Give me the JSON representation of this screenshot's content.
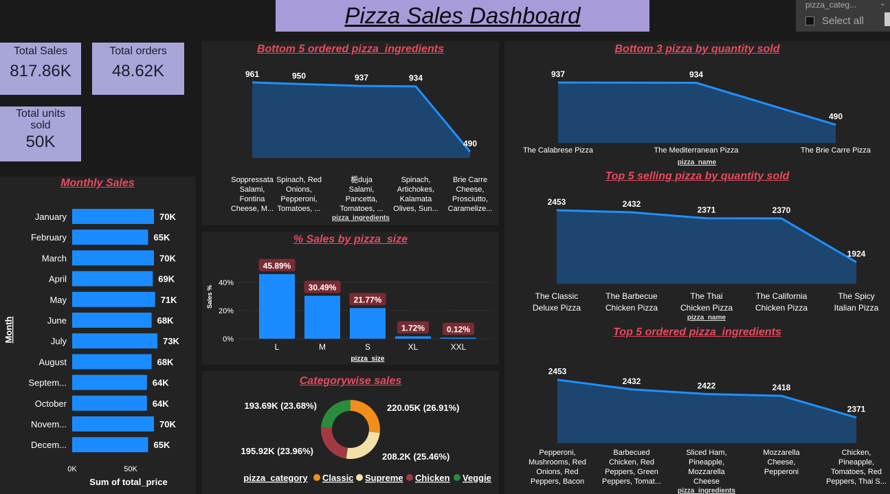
{
  "header": {
    "title": "Pizza Sales Dashboard",
    "slicer_label": "pizza_categ...",
    "slicer_select_all": "Select all"
  },
  "kpis": [
    {
      "label": "Total Sales",
      "value": "817.86K"
    },
    {
      "label": "Total orders",
      "value": "48.62K"
    },
    {
      "label": "Total units sold",
      "value": "50K"
    }
  ],
  "colors": {
    "line": "#1e90ff",
    "area": "#1c4570",
    "bar": "#1a8cff",
    "title": "#e84a5f",
    "classic": "#f28e1c",
    "supreme": "#f1e1a6",
    "chicken": "#a23a44",
    "veggie": "#2a8c3a"
  },
  "chart_data": [
    {
      "id": "bottom5ing",
      "type": "area",
      "title": "Bottom 5 ordered pizza_ingredients",
      "xlabel": "pizza_ingredients",
      "categories": [
        [
          "Soppressata",
          "Salami,",
          "Fontina",
          "Cheese, M..."
        ],
        [
          "Spinach, Red",
          "Onions,",
          "Pepperoni,",
          "Tomatoes, ..."
        ],
        [
          "梔duja",
          "Salami,",
          "Pancetta,",
          "Tomatoes, ..."
        ],
        [
          "Spinach,",
          "Artichokes,",
          "Kalamata",
          "Olives, Sun..."
        ],
        [
          "Brie Carre",
          "Cheese,",
          "Prosciutto,",
          "Caramelize..."
        ]
      ],
      "values": [
        961,
        950,
        937,
        934,
        490
      ],
      "labels": [
        "961",
        "950",
        "937",
        "934",
        "490"
      ]
    },
    {
      "id": "bottom3pizza",
      "type": "area",
      "title": "Bottom 3 pizza by quantity sold",
      "xlabel": "pizza_name",
      "categories": [
        [
          "The Calabrese Pizza"
        ],
        [
          "The Mediterranean Pizza"
        ],
        [
          "The Brie Carre Pizza"
        ]
      ],
      "values": [
        937,
        934,
        490
      ],
      "labels": [
        "937",
        "934",
        "490"
      ]
    },
    {
      "id": "top5pizza",
      "type": "area",
      "title": "Top 5 selling pizza by quantity sold",
      "xlabel": "pizza_name",
      "categories": [
        [
          "The Classic",
          "Deluxe Pizza"
        ],
        [
          "The Barbecue",
          "Chicken Pizza"
        ],
        [
          "The Thai",
          "Chicken Pizza"
        ],
        [
          "The California",
          "Chicken Pizza"
        ],
        [
          "The Spicy",
          "Italian Pizza"
        ]
      ],
      "values": [
        2453,
        2432,
        2371,
        2370,
        1924
      ],
      "labels": [
        "2453",
        "2432",
        "2371",
        "2370",
        "1924"
      ]
    },
    {
      "id": "top5ing",
      "type": "area",
      "title": "Top 5 ordered pizza_ingredients",
      "xlabel": "pizza_ingredients",
      "categories": [
        [
          "Pepperoni,",
          "Mushrooms, Red",
          "Onions, Red",
          "Peppers, Bacon"
        ],
        [
          "Barbecued",
          "Chicken, Red",
          "Peppers, Green",
          "Peppers, Tomat..."
        ],
        [
          "Sliced Ham,",
          "Pineapple,",
          "Mozzarella",
          "Cheese"
        ],
        [
          "Mozzarella",
          "Cheese,",
          "Pepperoni"
        ],
        [
          "Chicken,",
          "Pineapple,",
          "Tomatoes, Red",
          "Peppers, Thai S..."
        ]
      ],
      "values": [
        2453,
        2432,
        2422,
        2418,
        2371
      ],
      "labels": [
        "2453",
        "2432",
        "2422",
        "2418",
        "2371"
      ]
    },
    {
      "id": "monthly",
      "type": "bar",
      "orientation": "horizontal",
      "title": "Monthly Sales",
      "ylabel": "Month",
      "xlabel": "Sum of total_price",
      "categories": [
        "January",
        "February",
        "March",
        "April",
        "May",
        "June",
        "July",
        "August",
        "Septem...",
        "October",
        "Novem...",
        "Decem..."
      ],
      "values": [
        70,
        65,
        70,
        69,
        71,
        68,
        73,
        68,
        64,
        64,
        70,
        65
      ],
      "labels": [
        "70K",
        "65K",
        "70K",
        "69K",
        "71K",
        "68K",
        "73K",
        "68K",
        "64K",
        "64K",
        "70K",
        "65K"
      ],
      "xticks": [
        "0K",
        "50K"
      ],
      "xlim": [
        0,
        80
      ]
    },
    {
      "id": "size",
      "type": "bar",
      "title": "% Sales by pizza_size",
      "xlabel": "pizza_size",
      "ylabel": "Sales %",
      "categories": [
        "L",
        "M",
        "S",
        "XL",
        "XXL"
      ],
      "values": [
        45.89,
        30.49,
        21.77,
        1.72,
        0.12
      ],
      "labels": [
        "45.89%",
        "30.49%",
        "21.77%",
        "1.72%",
        "0.12%"
      ],
      "yticks": [
        "0%",
        "20%",
        "40%"
      ],
      "ylim": [
        0,
        50
      ],
      "grid": true
    },
    {
      "id": "category",
      "type": "pie",
      "title": "Categorywise sales",
      "legend_title": "pizza_category",
      "categories": [
        "Classic",
        "Supreme",
        "Chicken",
        "Veggie"
      ],
      "values": [
        220.05,
        208.2,
        195.92,
        193.69
      ],
      "labels": [
        "220.05K (26.91%)",
        "208.2K (25.46%)",
        "195.92K (23.96%)",
        "193.69K (23.68%)"
      ]
    }
  ]
}
